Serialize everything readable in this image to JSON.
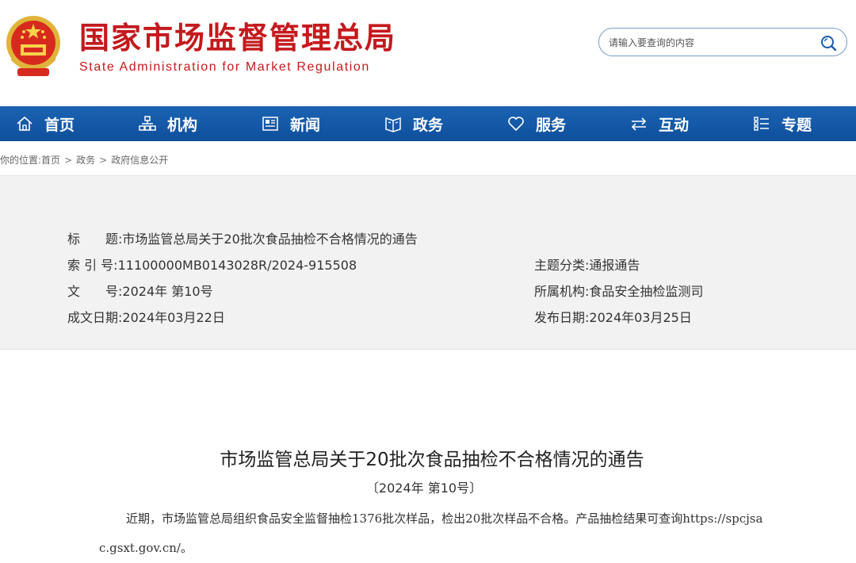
{
  "header": {
    "title_cn": "国家市场监督管理总局",
    "title_en": "State Administration for Market Regulation",
    "emblem_icon": "national-emblem-icon"
  },
  "search": {
    "placeholder": "请输入要查询的内容",
    "icon": "search-icon"
  },
  "nav": {
    "items": [
      {
        "label": "首页",
        "icon": "home-icon"
      },
      {
        "label": "机构",
        "icon": "org-chart-icon"
      },
      {
        "label": "新闻",
        "icon": "newspaper-icon"
      },
      {
        "label": "政务",
        "icon": "document-icon"
      },
      {
        "label": "服务",
        "icon": "heart-icon"
      },
      {
        "label": "互动",
        "icon": "exchange-icon"
      },
      {
        "label": "专题",
        "icon": "list-icon"
      }
    ]
  },
  "breadcrumb": {
    "prefix": "你的位置:",
    "items": [
      "首页",
      "政务",
      "政府信息公开"
    ],
    "separator": ">"
  },
  "info": {
    "title_label": "标　　题:",
    "title_value": "市场监管总局关于20批次食品抽检不合格情况的通告",
    "index_label": "索 引 号:",
    "index_value": "11100000MB0143028R/2024-915508",
    "category_label": "主题分类:",
    "category_value": "通报通告",
    "doc_label": "文　　号:",
    "doc_value": "2024年 第10号",
    "org_label": "所属机构:",
    "org_value": "食品安全抽检监测司",
    "created_label": "成文日期:",
    "created_value": "2024年03月22日",
    "published_label": "发布日期:",
    "published_value": "2024年03月25日"
  },
  "article": {
    "title": "市场监管总局关于20批次食品抽检不合格情况的通告",
    "number": "〔2024年 第10号〕",
    "body": "近期，市场监管总局组织食品安全监督抽检1376批次样品，检出20批次样品不合格。产品抽检结果可查询https://spcjsac.gsxt.gov.cn/。"
  },
  "colors": {
    "brand_red": "#c4191d",
    "nav_blue": "#1760b0",
    "info_bg": "#f2f2f2"
  }
}
